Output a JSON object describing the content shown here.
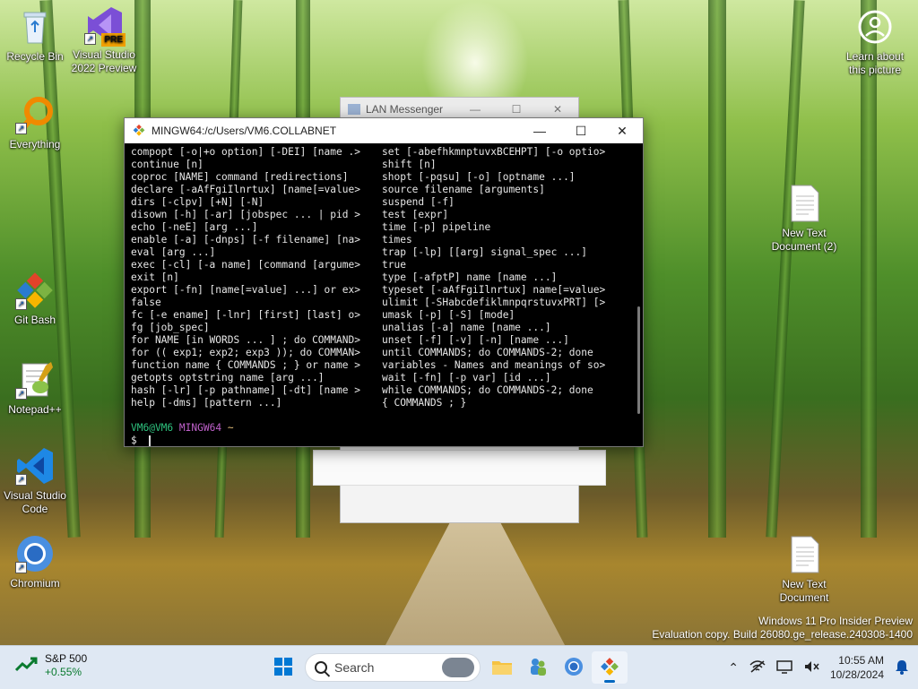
{
  "desktop": {
    "icons": [
      {
        "name": "Recycle Bin",
        "line2": ""
      },
      {
        "name": "Visual Studio",
        "line2": "2022 Preview",
        "badge": "PRE"
      },
      {
        "name": "Everything",
        "line2": ""
      },
      {
        "name": "Git Bash",
        "line2": ""
      },
      {
        "name": "Notepad++",
        "line2": ""
      },
      {
        "name": "Visual Studio",
        "line2": "Code"
      },
      {
        "name": "Chromium",
        "line2": ""
      },
      {
        "name": "Learn about",
        "line2": "this picture"
      },
      {
        "name": "New Text",
        "line2": "Document (2)"
      },
      {
        "name": "New Text",
        "line2": "Document"
      }
    ],
    "watermark": {
      "line1": "Windows 11 Pro Insider Preview",
      "line2": "Evaluation copy. Build 26080.ge_release.240308-1400"
    }
  },
  "lan_window": {
    "title": "LAN Messenger",
    "minimize": "—",
    "maximize": "☐",
    "close": "✕"
  },
  "terminal": {
    "title": "MINGW64:/c/Users/VM6.COLLABNET",
    "minimize": "—",
    "maximize": "☐",
    "close": "✕",
    "left_column": [
      "compopt [-o|+o option] [-DEI] [name .>",
      "continue [n]",
      "coproc [NAME] command [redirections]",
      "declare [-aAfFgiIlnrtux] [name[=value>",
      "dirs [-clpv] [+N] [-N]",
      "disown [-h] [-ar] [jobspec ... | pid >",
      "echo [-neE] [arg ...]",
      "enable [-a] [-dnps] [-f filename] [na>",
      "eval [arg ...]",
      "exec [-cl] [-a name] [command [argume>",
      "exit [n]",
      "export [-fn] [name[=value] ...] or ex>",
      "false",
      "fc [-e ename] [-lnr] [first] [last] o>",
      "fg [job_spec]",
      "for NAME [in WORDS ... ] ; do COMMAND>",
      "for (( exp1; exp2; exp3 )); do COMMAN>",
      "function name { COMMANDS ; } or name >",
      "getopts optstring name [arg ...]",
      "hash [-lr] [-p pathname] [-dt] [name >",
      "help [-dms] [pattern ...]"
    ],
    "right_column": [
      "set [-abefhkmnptuvxBCEHPT] [-o optio>",
      "shift [n]",
      "shopt [-pqsu] [-o] [optname ...]",
      "source filename [arguments]",
      "suspend [-f]",
      "test [expr]",
      "time [-p] pipeline",
      "times",
      "trap [-lp] [[arg] signal_spec ...]",
      "true",
      "type [-afptP] name [name ...]",
      "typeset [-aAfFgiIlnrtux] name[=value>",
      "ulimit [-SHabcdefiklmnpqrstuvxPRT] [>",
      "umask [-p] [-S] [mode]",
      "unalias [-a] name [name ...]",
      "unset [-f] [-v] [-n] [name ...]",
      "until COMMANDS; do COMMANDS-2; done",
      "variables - Names and meanings of so>",
      "wait [-fn] [-p var] [id ...]",
      "while COMMANDS; do COMMANDS-2; done",
      "{ COMMANDS ; }"
    ],
    "prompt_user": "VM6@VM6",
    "prompt_host": "MINGW64",
    "prompt_path": "~",
    "prompt_symbol": "$"
  },
  "taskbar": {
    "stock_name": "S&P 500",
    "stock_change": "+0.55%",
    "search_placeholder": "Search",
    "time": "10:55 AM",
    "date": "10/28/2024"
  }
}
